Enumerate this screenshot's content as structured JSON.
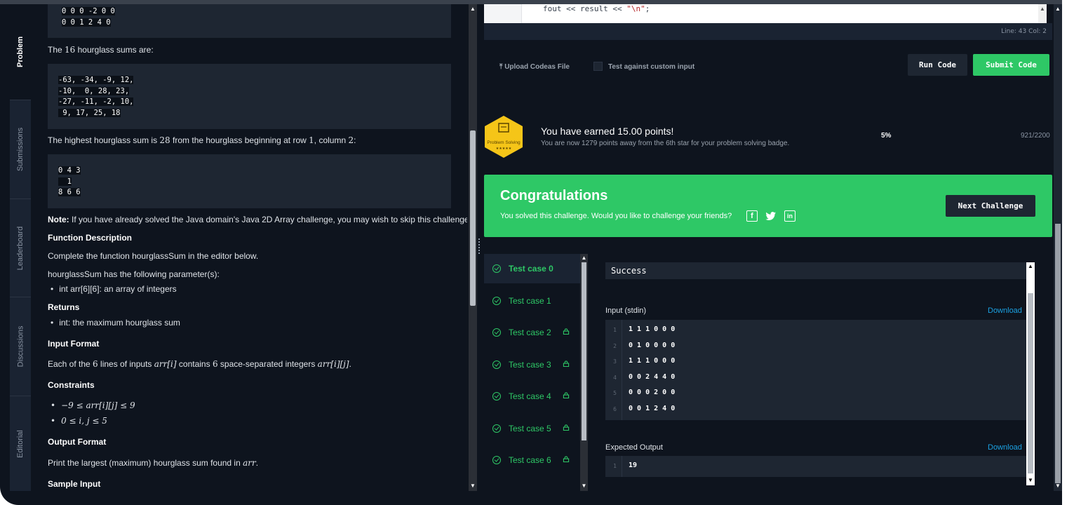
{
  "nav_tabs": [
    {
      "label": "Problem",
      "active": true
    },
    {
      "label": "Submissions",
      "active": false
    },
    {
      "label": "Leaderboard",
      "active": false
    },
    {
      "label": "Discussions",
      "active": false
    },
    {
      "label": "Editorial",
      "active": false
    }
  ],
  "problem": {
    "top_matrix_lines": [
      "0 0 0 -2 0 0",
      "0 0 1 2 4 0"
    ],
    "sums_intro_pre": "The ",
    "sums_count": "16",
    "sums_intro_post": " hourglass sums are:",
    "sums_lines": [
      "-63, -34, -9, 12,",
      "-10,  0, 28, 23,",
      "-27, -11, -2, 10,",
      " 9, 17, 25, 18"
    ],
    "highest_pre": "The highest hourglass sum is ",
    "highest_value": "28",
    "highest_mid": " from the hourglass beginning at row ",
    "highest_row": "1",
    "highest_col_text": ", column ",
    "highest_col": "2",
    "highest_end": ":",
    "hourglass_lines": [
      "0 4 3",
      "  1",
      "8 6 6"
    ],
    "note_label": "Note:",
    "note_text": " If you have already solved the Java domain's Java 2D Array challenge, you may wish to skip this challenge.",
    "function_description_heading": "Function Description",
    "function_description_text": "Complete the function hourglassSum in the editor below.",
    "params_text": "hourglassSum has the following parameter(s):",
    "params": [
      "int arr[6][6]: an array of integers"
    ],
    "returns_heading": "Returns",
    "returns": [
      "int: the maximum hourglass sum"
    ],
    "input_format_heading": "Input Format",
    "input_format_pre": "Each of the ",
    "input_format_n": "6",
    "input_format_mid": " lines of inputs ",
    "input_format_arr_i": "arr[i]",
    "input_format_mid2": " contains ",
    "input_format_m": "6",
    "input_format_mid3": " space-separated integers ",
    "input_format_arr_ij": "arr[i][j]",
    "input_format_end": ".",
    "constraints_heading": "Constraints",
    "constraints": [
      "−9 ≤ arr[i][j] ≤ 9",
      "0 ≤ i, j ≤ 5"
    ],
    "output_format_heading": "Output Format",
    "output_format_pre": "Print the largest (maximum) hourglass sum found in ",
    "output_format_arr": "arr",
    "output_format_end": ".",
    "sample_input_heading": "Sample Input"
  },
  "editor": {
    "code_pre": "fout << result << ",
    "code_str": "\"\\n\"",
    "code_end": ";",
    "line_col": "Line: 43 Col: 2"
  },
  "toolbar": {
    "upload_label": "Upload Codeas File",
    "custom_input_label": "Test against custom input",
    "run_label": "Run Code",
    "submit_label": "Submit Code"
  },
  "points": {
    "badge_label": "Problem Solving",
    "badge_stars": "★★★★★",
    "title": "You have earned 15.00 points!",
    "subtitle": "You are now 1279 points away from the 6th star for your problem solving badge.",
    "percent": "5%",
    "progress": "921/2200"
  },
  "congrats": {
    "title": "Congratulations",
    "subtitle": "You solved this challenge. Would you like to challenge your friends?",
    "next_label": "Next Challenge"
  },
  "test_cases": [
    {
      "label": "Test case 0",
      "locked": false,
      "active": true
    },
    {
      "label": "Test case 1",
      "locked": false,
      "active": false
    },
    {
      "label": "Test case 2",
      "locked": true,
      "active": false
    },
    {
      "label": "Test case 3",
      "locked": true,
      "active": false
    },
    {
      "label": "Test case 4",
      "locked": true,
      "active": false
    },
    {
      "label": "Test case 5",
      "locked": true,
      "active": false
    },
    {
      "label": "Test case 6",
      "locked": true,
      "active": false
    }
  ],
  "results": {
    "status": "Success",
    "input_label": "Input (stdin)",
    "download_label": "Download",
    "input_lines": [
      {
        "n": "1",
        "t": "1 1 1 0 0 0"
      },
      {
        "n": "2",
        "t": "0 1 0 0 0 0"
      },
      {
        "n": "3",
        "t": "1 1 1 0 0 0"
      },
      {
        "n": "4",
        "t": "0 0 2 4 4 0"
      },
      {
        "n": "5",
        "t": "0 0 0 2 0 0"
      },
      {
        "n": "6",
        "t": "0 0 1 2 4 0"
      }
    ],
    "expected_label": "Expected Output",
    "expected_lines": [
      {
        "n": "1",
        "t": "19"
      }
    ]
  },
  "colors": {
    "accent_green": "#2ec866",
    "link_blue": "#1ba1e2",
    "background": "#0e141e",
    "panel": "#1e2632"
  }
}
